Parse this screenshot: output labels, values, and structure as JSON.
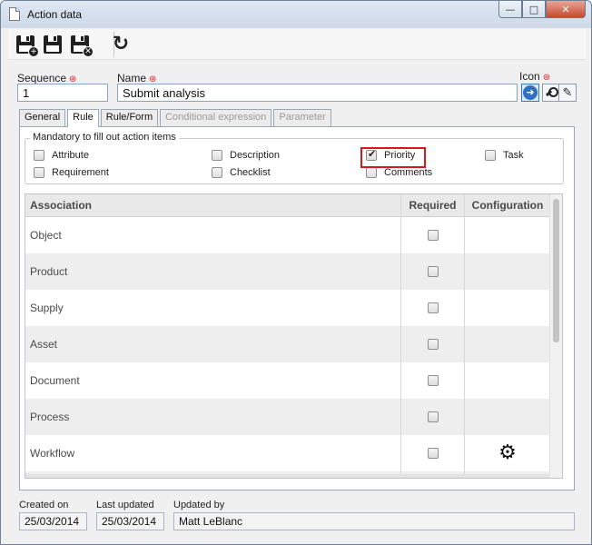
{
  "window": {
    "title": "Action data",
    "minimize": "—",
    "maximize": "□",
    "close": "✕"
  },
  "toolbar": {
    "buttons": [
      {
        "name": "save-and-new",
        "badge": "+"
      },
      {
        "name": "save"
      },
      {
        "name": "save-and-close",
        "badge": "✕"
      },
      {
        "name": "refresh",
        "glyph": "↻"
      }
    ]
  },
  "form": {
    "sequence": {
      "label": "Sequence",
      "value": "1"
    },
    "name": {
      "label": "Name",
      "value": "Submit analysis"
    },
    "icon": {
      "label": "Icon"
    },
    "required_mark": "⊛"
  },
  "tabs": [
    {
      "label": "General",
      "state": "normal"
    },
    {
      "label": "Rule",
      "state": "active"
    },
    {
      "label": "Rule/Form",
      "state": "normal"
    },
    {
      "label": "Conditional expression",
      "state": "disabled"
    },
    {
      "label": "Parameter",
      "state": "disabled"
    }
  ],
  "mandatory": {
    "legend": "Mandatory to fill out action items",
    "items": [
      {
        "label": "Attribute",
        "checked": false
      },
      {
        "label": "Description",
        "checked": false
      },
      {
        "label": "Priority",
        "checked": true
      },
      {
        "label": "Task",
        "checked": false
      },
      {
        "label": "Requirement",
        "checked": false
      },
      {
        "label": "Checklist",
        "checked": false
      },
      {
        "label": "Comments",
        "checked": false
      }
    ]
  },
  "grid": {
    "columns": [
      "Association",
      "Required",
      "Configuration"
    ],
    "rows": [
      {
        "association": "Object",
        "required": false,
        "configuration": ""
      },
      {
        "association": "Product",
        "required": false,
        "configuration": ""
      },
      {
        "association": "Supply",
        "required": false,
        "configuration": ""
      },
      {
        "association": "Asset",
        "required": false,
        "configuration": ""
      },
      {
        "association": "Document",
        "required": false,
        "configuration": ""
      },
      {
        "association": "Process",
        "required": false,
        "configuration": ""
      },
      {
        "association": "Workflow",
        "required": false,
        "configuration": "gear-icon"
      }
    ],
    "gear_glyph": "⚙"
  },
  "footer": {
    "created_on": {
      "label": "Created on",
      "value": "25/03/2014"
    },
    "last_updated": {
      "label": "Last updated",
      "value": "25/03/2014"
    },
    "updated_by": {
      "label": "Updated by",
      "value": "Matt LeBlanc"
    }
  },
  "colors": {
    "required_mark": "#e21b1b",
    "highlight_border": "#d6191c",
    "icon_arrow": "#2f6fbd"
  }
}
